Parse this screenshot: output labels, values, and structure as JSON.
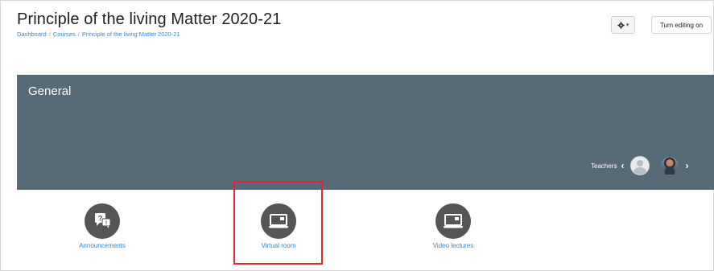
{
  "header": {
    "title": "Principle of the living Matter 2020-21",
    "breadcrumb": [
      "Dashboard",
      "Courses",
      "Principle of the living Matter 2020-21"
    ],
    "settings_icon": "gear-icon",
    "turn_editing_label": "Turn editing on"
  },
  "section": {
    "title": "General",
    "teachers_label": "Teachers"
  },
  "activities": [
    {
      "label": "Announcements",
      "icon": "announcements-icon"
    },
    {
      "label": "Virtual room",
      "icon": "virtual-room-icon"
    },
    {
      "label": "Video lectures",
      "icon": "video-lectures-icon"
    }
  ],
  "colors": {
    "banner": "#566a78",
    "link": "#3a86c8",
    "highlight": "#e4252d"
  }
}
